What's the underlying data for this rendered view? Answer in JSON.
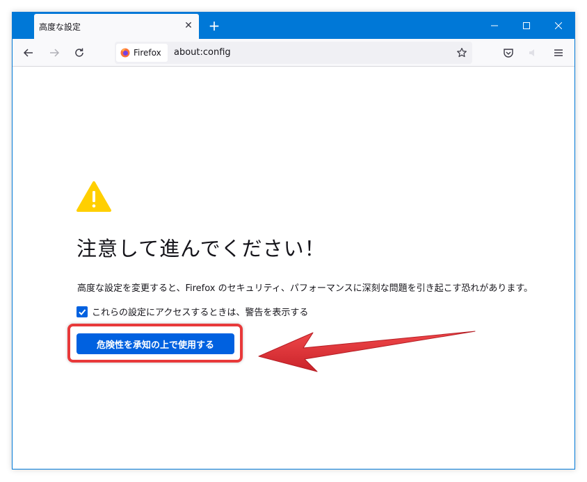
{
  "tab": {
    "title": "高度な設定"
  },
  "urlbar": {
    "identity_label": "Firefox",
    "url": "about:config"
  },
  "warning": {
    "heading": "注意して進んでください！",
    "message": "高度な設定を変更すると、Firefox のセキュリティ、パフォーマンスに深刻な問題を引き起こす恐れがあります。",
    "checkbox_label": "これらの設定にアクセスするときは、警告を表示する",
    "checkbox_checked": true,
    "accept_button_label": "危険性を承知の上で使用する"
  },
  "colors": {
    "titlebar": "#0078d7",
    "primary_button": "#0061e0",
    "warning_icon": "#ffcf00",
    "annotation_red": "#e8393a"
  },
  "icons": {
    "tab_close": "close-icon",
    "new_tab": "plus-icon",
    "back": "arrow-left-icon",
    "forward": "arrow-right-icon",
    "reload": "reload-icon",
    "bookmark": "star-icon",
    "pocket": "pocket-icon",
    "menu": "hamburger-icon",
    "warning": "warning-triangle-icon",
    "annotation": "red-arrow-icon"
  }
}
